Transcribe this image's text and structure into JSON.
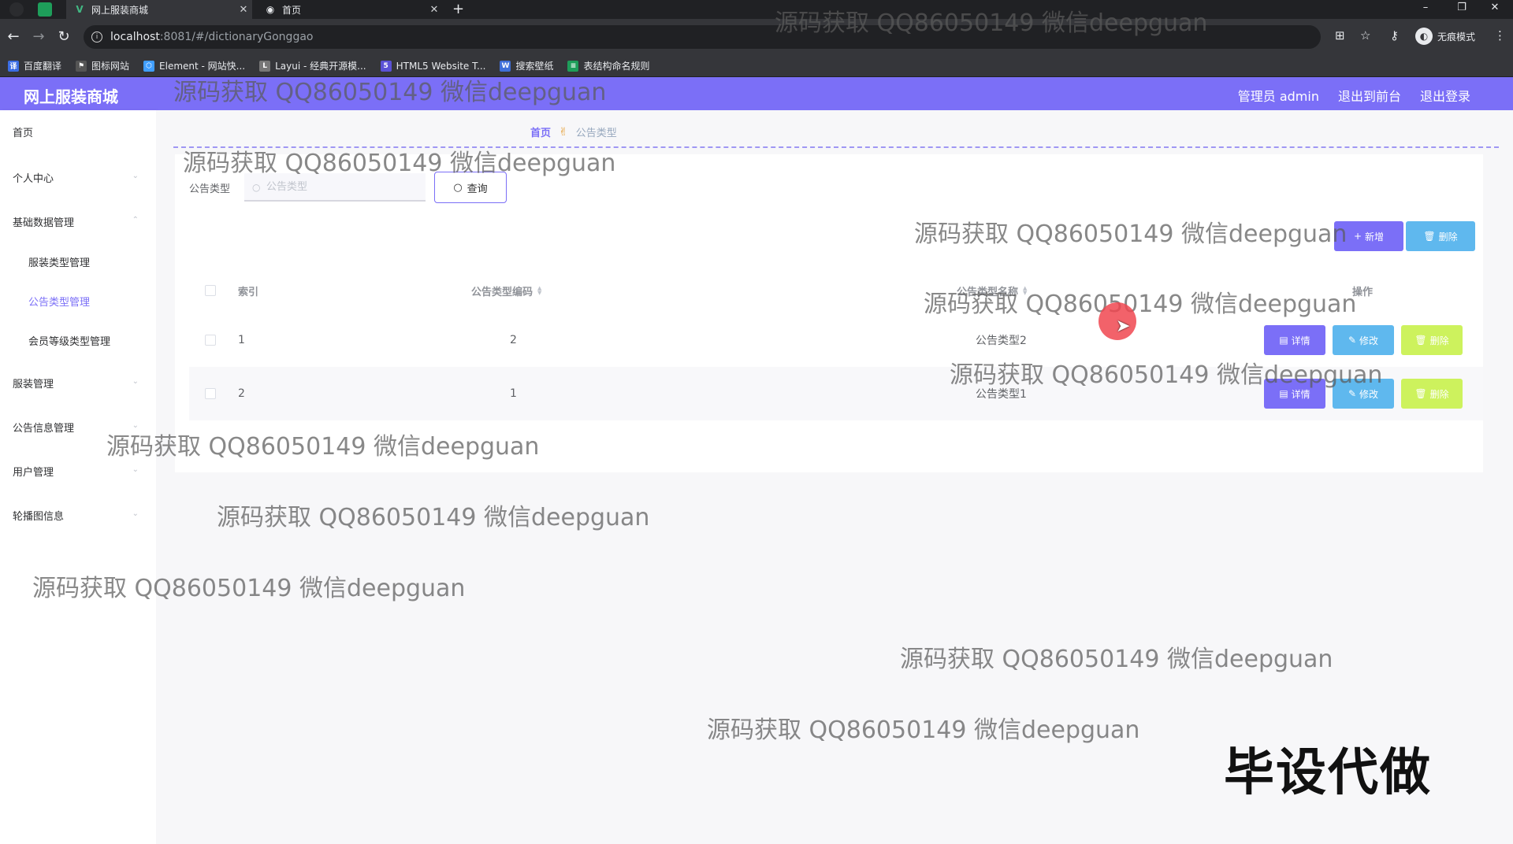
{
  "browser": {
    "tabs": [
      {
        "label": "网上服装商城",
        "active": true
      },
      {
        "label": "首页",
        "active": false
      }
    ],
    "url_host": "localhost",
    "url_path": ":8081/#/dictionaryGonggao",
    "incognito_label": "无痕模式",
    "bookmarks": [
      {
        "label": "百度翻译",
        "icon": "baidu-translate-icon",
        "color": "#3b6de4"
      },
      {
        "label": "图标网站",
        "icon": "flag-icon",
        "color": "#555555"
      },
      {
        "label": "Element - 网站快...",
        "icon": "element-icon",
        "color": "#409eff"
      },
      {
        "label": "Layui - 经典开源模...",
        "icon": "layui-icon",
        "color": "#777777"
      },
      {
        "label": "HTML5 Website T...",
        "icon": "html5-icon",
        "color": "#5b52d6"
      },
      {
        "label": "搜索壁纸",
        "icon": "wallpaper-icon",
        "color": "#3f6fd8"
      },
      {
        "label": "表结构命名规则",
        "icon": "sheet-icon",
        "color": "#1e9e5a"
      }
    ]
  },
  "header": {
    "title": "网上服装商城",
    "links": [
      "管理员 admin",
      "退出到前台",
      "退出登录"
    ],
    "color": "#7b6ff7"
  },
  "sidebar": {
    "items": [
      {
        "label": "首页",
        "type": "top"
      },
      {
        "label": "个人中心",
        "type": "top"
      },
      {
        "label": "基础数据管理",
        "type": "top"
      },
      {
        "label": "服装类型管理",
        "type": "sub"
      },
      {
        "label": "公告类型管理",
        "type": "sub",
        "active": true
      },
      {
        "label": "会员等级类型管理",
        "type": "sub"
      },
      {
        "label": "服装管理",
        "type": "top"
      },
      {
        "label": "公告信息管理",
        "type": "top"
      },
      {
        "label": "用户管理",
        "type": "top"
      },
      {
        "label": "轮播图信息",
        "type": "top"
      }
    ]
  },
  "breadcrumb": {
    "home": "首页",
    "current": "公告类型"
  },
  "search": {
    "label": "公告类型",
    "placeholder": "公告类型",
    "button": "查询"
  },
  "actions": {
    "add": "新增",
    "delete": "删除"
  },
  "table": {
    "columns": [
      "索引",
      "公告类型编码",
      "公告类型名称",
      "操作"
    ],
    "rows": [
      {
        "index": "1",
        "code": "2",
        "name": "公告类型2"
      },
      {
        "index": "2",
        "code": "1",
        "name": "公告类型1"
      }
    ],
    "row_actions": {
      "detail": "详情",
      "edit": "修改",
      "delete": "删除"
    }
  },
  "watermarks": [
    "源码获取 QQ86050149 微信deepguan",
    "源码获取 QQ86050149 微信deepguan",
    "源码获取 QQ86050149 微信deepguan",
    "源码获取 QQ86050149 微信deepguan",
    "源码获取 QQ86050149 微信deepguan",
    "源码获取 QQ86050149 微信deepguan",
    "源码获取 QQ86050149 微信deepguan",
    "源码获取 QQ86050149 微信deepguan",
    "源码获取 QQ86050149 微信deepguan",
    "源码获取 QQ86050149 微信deepguan",
    "源码获取 QQ86050149 微信deepguan"
  ],
  "stamp": "毕设代做"
}
